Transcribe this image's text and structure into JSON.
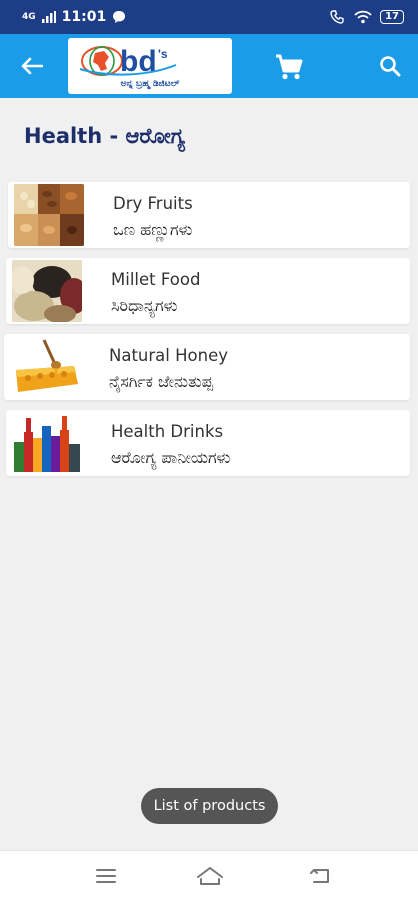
{
  "status_bar": {
    "network": "4G",
    "time": "11:01",
    "battery": "17"
  },
  "app_bar": {
    "logo_text": "abd's",
    "logo_tagline": "ಅನ್ನ ಬ್ರಹ್ಮ ಡಿಜಿಟಲ್"
  },
  "page": {
    "title": "Health - ಆರೋಗ್ಯ"
  },
  "categories": [
    {
      "name": "Dry Fruits",
      "subtitle": "ಒಣ ಹಣ್ಣುಗಳು",
      "image": "dry-fruits"
    },
    {
      "name": "Millet Food",
      "subtitle": "ಸಿರಿಧಾನ್ಯಗಳು",
      "image": "millet-food"
    },
    {
      "name": "Natural Honey",
      "subtitle": "ನೈಸರ್ಗಿಕ ಜೇನುತುಪ್ಪ",
      "image": "natural-honey"
    },
    {
      "name": "Health Drinks",
      "subtitle": "ಆರೋಗ್ಯ ಪಾನೀಯಗಳು",
      "image": "health-drinks"
    }
  ],
  "toast": {
    "message": "List of products"
  },
  "colors": {
    "status_bar": "#1d3d86",
    "app_bar": "#1a9ce8",
    "title": "#1d2f6b",
    "toast": "#555555"
  },
  "icons": [
    "back-arrow-icon",
    "cart-icon",
    "search-icon",
    "menu-icon",
    "home-icon",
    "back-icon"
  ]
}
